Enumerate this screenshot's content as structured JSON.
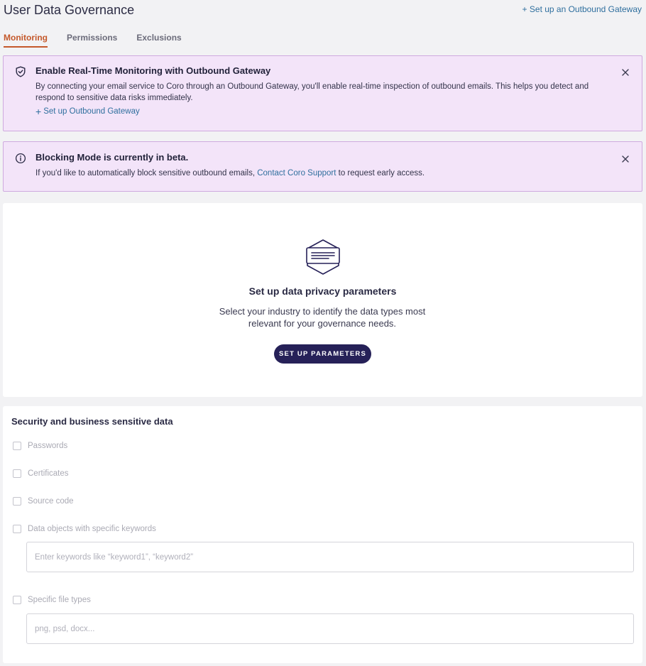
{
  "header": {
    "title": "User Data Governance",
    "setup_link": "+ Set up an Outbound Gateway"
  },
  "tabs": [
    {
      "label": "Monitoring",
      "active": true
    },
    {
      "label": "Permissions",
      "active": false
    },
    {
      "label": "Exclusions",
      "active": false
    }
  ],
  "gateway_banner": {
    "icon": "shield-check-icon",
    "title": "Enable Real-Time Monitoring with Outbound Gateway",
    "text": "By connecting your email service to Coro through an Outbound Gateway, you'll enable real-time inspection of outbound emails. This helps you detect and respond to sensitive data risks immediately.",
    "action_label": "Set up Outbound Gateway"
  },
  "beta_banner": {
    "icon": "info-icon",
    "title": "Blocking Mode is currently in beta.",
    "text_before": "If you'd like to automatically block sensitive outbound emails, ",
    "link": "Contact Coro Support",
    "text_after": " to request early access."
  },
  "empty_state": {
    "title": "Set up data privacy parameters",
    "description": "Select your industry to identify the data types most relevant for your governance needs.",
    "button_label": "SET UP PARAMETERS"
  },
  "sensitive_data": {
    "title": "Security and business sensitive data",
    "options": [
      {
        "label": "Passwords",
        "checked": false
      },
      {
        "label": "Certificates",
        "checked": false
      },
      {
        "label": "Source code",
        "checked": false
      },
      {
        "label": "Data objects with specific keywords",
        "checked": false
      },
      {
        "label": "Specific file types",
        "checked": false
      }
    ],
    "keywords_placeholder": "Enter keywords like “keyword1”, “keyword2”",
    "filetypes_placeholder": "png, psd, docx..."
  },
  "colors": {
    "accent": "#c4582a",
    "link": "#2f6f9e",
    "primary_button": "#262158",
    "banner_bg": "#f3e4f9",
    "banner_border": "#cfaadf"
  }
}
